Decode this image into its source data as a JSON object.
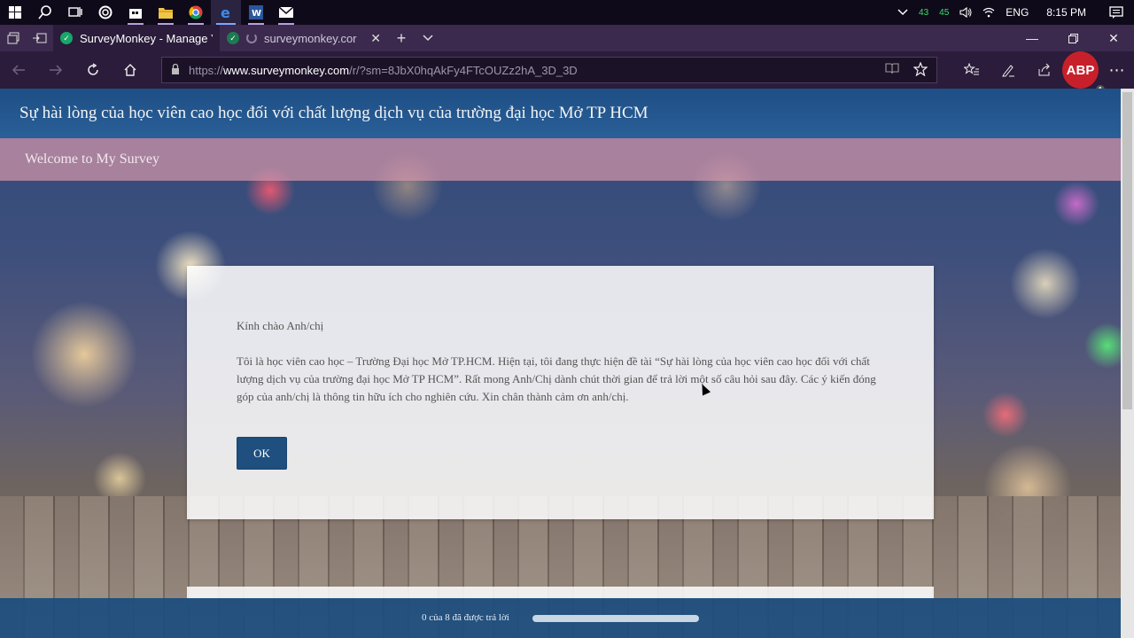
{
  "taskbar": {
    "icons": [
      "windows-icon",
      "search-icon",
      "task-view-icon",
      "cortana-icon",
      "store-icon",
      "file-explorer-icon",
      "chrome-icon",
      "edge-icon",
      "word-icon",
      "mail-icon"
    ],
    "tray": {
      "counter_1": "43",
      "counter_2": "45",
      "language": "ENG",
      "time": "8:15 PM"
    }
  },
  "browser": {
    "tabs": [
      {
        "label": "SurveyMonkey - Manage Yc",
        "active": true
      },
      {
        "label": "surveymonkey.cor",
        "active": false
      }
    ],
    "url": {
      "prefix": "https://",
      "host": "www.surveymonkey.com",
      "path": "/r/?sm=8JbX0hqAkFy4FTcOUZz2hA_3D_3D"
    },
    "adblock_badge": "ABP",
    "adblock_count": "1"
  },
  "survey": {
    "title": "Sự hài lòng của học viên cao học đối với chất lượng dịch vụ của trường đại học Mở TP HCM",
    "subtitle": "Welcome to My Survey",
    "greeting": "Kính chào Anh/chị",
    "intro": "Tôi là học viên cao học – Trường Đại học Mở TP.HCM. Hiện tại, tôi đang thực hiện đề tài “Sự hài lòng của học viên cao học đối với chất lượng dịch vụ của trường đại học Mở TP HCM”. Rất mong Anh/Chị dành chút thời gian để trả lời một số câu hỏi sau đây. Các ý kiến đóng góp của anh/chị là thông tin hữu ích cho nghiên cứu. Xin chân thành cảm ơn anh/chị.",
    "ok_label": "OK",
    "progress_text": "0 của 8 đã được trả lời",
    "progress_fraction": 0
  },
  "colors": {
    "header_blue": "#1e4f86",
    "subheader_pink": "#d496aa",
    "button_blue": "#1e4f7e"
  }
}
